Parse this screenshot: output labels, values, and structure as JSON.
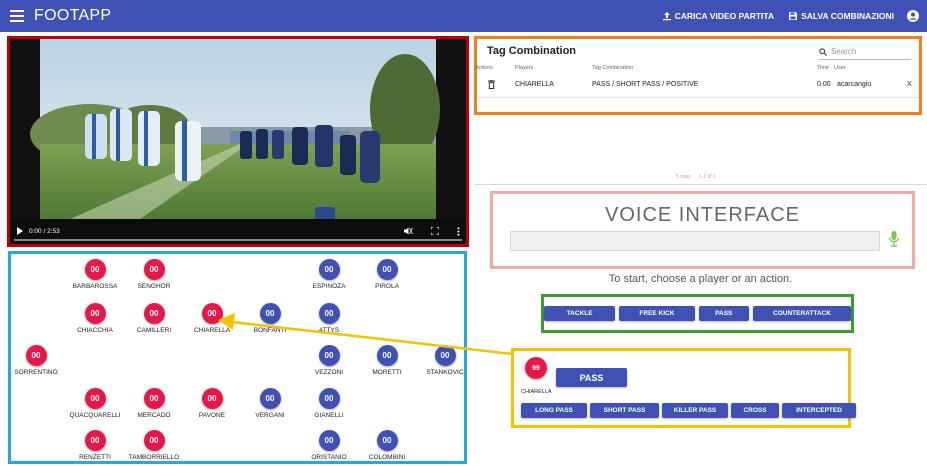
{
  "app": {
    "title": "FOOTAPP"
  },
  "toolbar": {
    "upload_label": "CARICA VIDEO PARTITA",
    "save_label": "SALVA COMBINAZIONI"
  },
  "video": {
    "time": "0:00 / 2:53"
  },
  "players": [
    {
      "number": "00",
      "name": "BARBAROSSA",
      "color": "red"
    },
    {
      "number": "00",
      "name": "SENGHOR",
      "color": "red"
    },
    {
      "number": "00",
      "name": "ESPINOZA",
      "color": "blue"
    },
    {
      "number": "00",
      "name": "PIROLA",
      "color": "blue"
    },
    {
      "number": "00",
      "name": "CHIACCHIA",
      "color": "red"
    },
    {
      "number": "00",
      "name": "CAMILLERI",
      "color": "red"
    },
    {
      "number": "00",
      "name": "CHIARELLA",
      "color": "red"
    },
    {
      "number": "00",
      "name": "BONFANTI",
      "color": "blue"
    },
    {
      "number": "00",
      "name": "ATTYS",
      "color": "blue"
    },
    {
      "number": "00",
      "name": "SORRENTINO",
      "color": "red"
    },
    {
      "number": "00",
      "name": "VEZZONI",
      "color": "blue"
    },
    {
      "number": "00",
      "name": "MORETTI",
      "color": "blue"
    },
    {
      "number": "00",
      "name": "STANKOVIC",
      "color": "blue"
    },
    {
      "number": "00",
      "name": "QUACQUARELLI",
      "color": "red"
    },
    {
      "number": "00",
      "name": "MERCADO",
      "color": "red"
    },
    {
      "number": "00",
      "name": "PAVONE",
      "color": "red"
    },
    {
      "number": "00",
      "name": "VERGANI",
      "color": "blue"
    },
    {
      "number": "00",
      "name": "GIANELLI",
      "color": "blue"
    },
    {
      "number": "00",
      "name": "RENZETTI",
      "color": "red"
    },
    {
      "number": "00",
      "name": "TAMBORRIELLO",
      "color": "red"
    },
    {
      "number": "00",
      "name": "ORISTANIO",
      "color": "blue"
    },
    {
      "number": "00",
      "name": "COLOMBINI",
      "color": "blue"
    }
  ],
  "tag_table": {
    "title": "Tag Combination",
    "search_placeholder": "Search",
    "headers": {
      "actions": "Actions",
      "players": "Players",
      "combination": "Tag Combination",
      "time": "Time",
      "user": "User"
    },
    "rows": [
      {
        "player": "CHIARELLA",
        "combination": "PASS / SHORT PASS / POSITIVE",
        "time": "0.00",
        "user": "acarcangiu",
        "remove": "X"
      }
    ],
    "pager": {
      "rows": "5 rows",
      "page": "1-1 of 1"
    }
  },
  "voice": {
    "title": "VOICE INTERFACE",
    "hint": "To start, choose a player or an action."
  },
  "actions": [
    "TACKLE",
    "FREE KICK",
    "PASS",
    "COUNTERATTACK"
  ],
  "selection": {
    "player_number": "99",
    "player_name": "CHIARELLA",
    "action": "PASS",
    "sub_actions": [
      "LONG PASS",
      "SHORT PASS",
      "KILLER PASS",
      "CROSS",
      "INTERCEPTED"
    ]
  },
  "colors": {
    "primary": "#3f51b5",
    "team_red": "#e8174a",
    "video_border": "#c00000",
    "players_border": "#29a8e0",
    "tag_border": "#f07e1c",
    "voice_border": "#f2a8a8",
    "actions_border": "#3c9c2f",
    "selection_border": "#f3c300",
    "mic": "#7ac943"
  }
}
